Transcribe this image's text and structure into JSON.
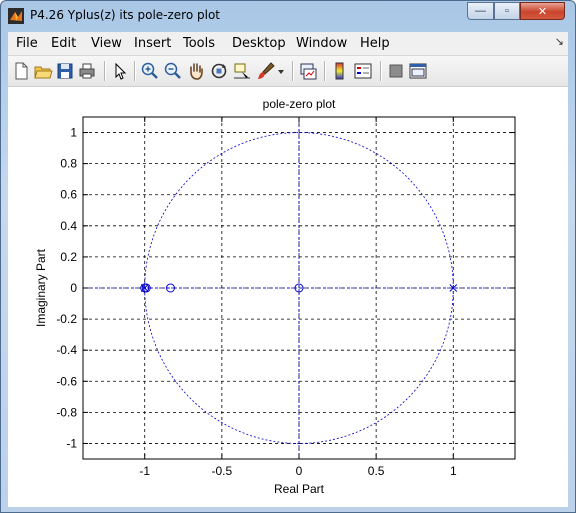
{
  "window": {
    "title": "P4.26 Yplus(z) its pole-zero plot",
    "controls": {
      "minimize": "—",
      "maximize": "▫",
      "close": "✕"
    }
  },
  "menu": {
    "items": [
      "File",
      "Edit",
      "View",
      "Insert",
      "Tools",
      "Desktop",
      "Window",
      "Help"
    ],
    "dock_arrow": "↘"
  },
  "toolbar": {
    "buttons": [
      "new-figure-icon",
      "open-file-icon",
      "save-icon",
      "print-icon",
      "pointer-arrow-icon",
      "zoom-in-icon",
      "zoom-out-icon",
      "pan-hand-icon",
      "rotate-3d-icon",
      "data-cursor-icon",
      "brush-icon",
      "brush-dropdown-icon",
      "link-plot-icon",
      "colorbar-icon",
      "legend-icon",
      "hide-plot-tools-icon",
      "show-plot-tools-icon"
    ]
  },
  "chart_data": {
    "type": "scatter",
    "title": "pole-zero plot",
    "xlabel": "Real Part",
    "ylabel": "Imaginary Part",
    "xlim": [
      -1.4,
      1.4
    ],
    "ylim": [
      -1.1,
      1.1
    ],
    "xticks": [
      -1,
      -0.5,
      0,
      0.5,
      1
    ],
    "xtick_labels": [
      "-1",
      "-0.5",
      "0",
      "0.5",
      "1"
    ],
    "yticks": [
      -1,
      -0.8,
      -0.6,
      -0.4,
      -0.2,
      0,
      0.2,
      0.4,
      0.6,
      0.8,
      1
    ],
    "ytick_labels": [
      "-1",
      "-0.8",
      "-0.6",
      "-0.4",
      "-0.2",
      "0",
      "0.2",
      "0.4",
      "0.6",
      "0.8",
      "1"
    ],
    "grid": true,
    "unit_circle": true,
    "zeros": [
      {
        "x": -1,
        "y": 0
      },
      {
        "x": -0.99,
        "y": 0
      },
      {
        "x": -0.833,
        "y": 0
      },
      {
        "x": 0,
        "y": 0
      }
    ],
    "poles": [
      {
        "x": -1,
        "y": 0
      },
      {
        "x": 1,
        "y": 0
      }
    ],
    "colors": {
      "marker": "#0000cc",
      "grid": "#000000"
    }
  }
}
